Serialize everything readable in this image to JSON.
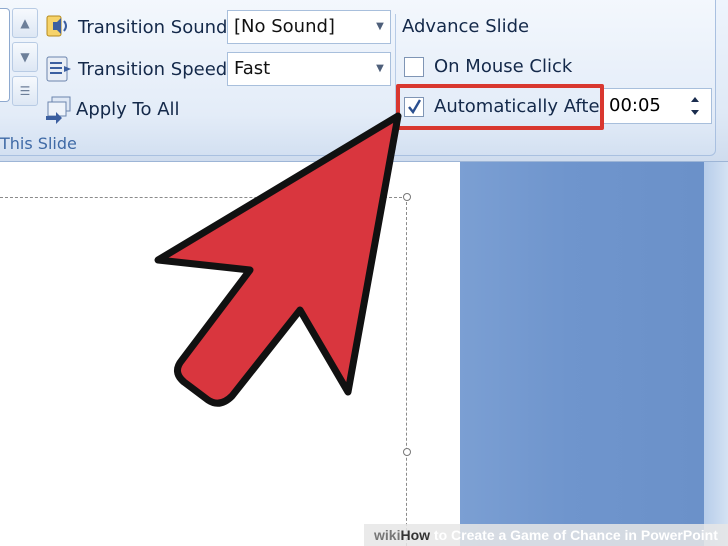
{
  "ribbon": {
    "transition_sound_label": "Transition Sound:",
    "transition_sound_value": "[No Sound]",
    "transition_speed_label": "Transition Speed:",
    "transition_speed_value": "Fast",
    "apply_to_all_label": "Apply To All",
    "group_label": "This Slide"
  },
  "advance": {
    "title": "Advance Slide",
    "on_mouse_click_label": "On Mouse Click",
    "on_mouse_click_checked": false,
    "automatically_after_label": "Automatically After:",
    "automatically_after_checked": true,
    "time_value": "00:05"
  },
  "watermark": {
    "wiki": "wiki",
    "how": "How",
    "rest": " to Create a Game of Chance in PowerPoint"
  },
  "colors": {
    "arrow_fill": "#d9363e",
    "highlight_border": "#d9372f",
    "slide_panel": "#7198ce"
  }
}
